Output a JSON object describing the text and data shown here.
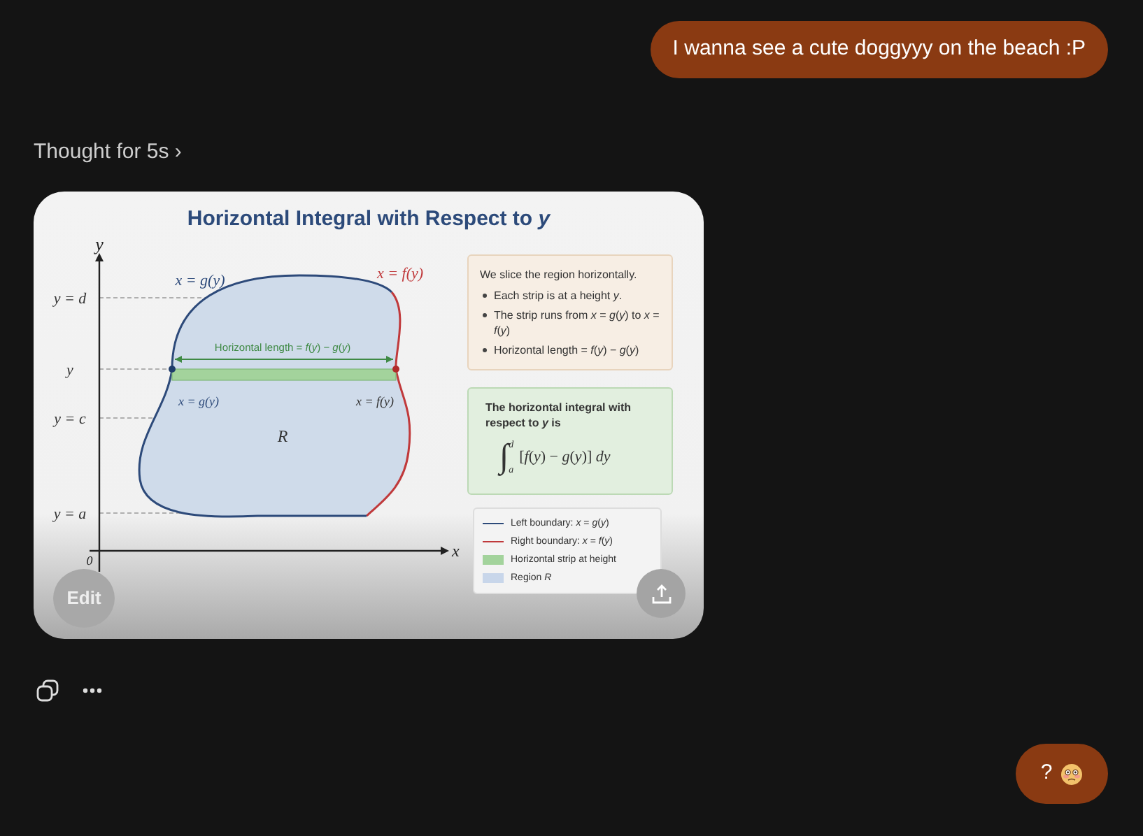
{
  "user_message": {
    "text": "I wanna see a cute doggyyy on the beach :P"
  },
  "thought": {
    "label": "Thought for 5s",
    "chevron": "›"
  },
  "image": {
    "title": "Horizontal Integral with Respect to *y*",
    "diagram": {
      "x_axis_label": "x",
      "y_axis_label": "y",
      "origin_label": "0",
      "level_labels": [
        "y = d",
        "y",
        "y = c",
        "y = a"
      ],
      "top_left_label": "x = g(y)",
      "top_right_label": "x = f(y)",
      "inner_left_label": "x = g(y)",
      "inner_right_label": "x = f(y)",
      "strip_label": "Horizontal length = *f*(*y*) − *g*(*y*)",
      "region_label": "R"
    },
    "explanation": {
      "intro": "We slice the region horizontally.",
      "bullets": [
        "Each strip is at a height *y*.",
        "The strip runs from *x* = *g*(*y*) to *x* = *f*(*y*)",
        "Horizontal length = *f*(*y*) − *g*(*y*)"
      ]
    },
    "integral_box": {
      "text": "The horizontal integral with respect to *y* is",
      "sign": "∫",
      "upper": "d",
      "lower": "a",
      "integrand": "[*f*(*y*) − *g*(*y*)] *dy*"
    },
    "legend": [
      {
        "kind": "line",
        "color": "#2d4a7a",
        "label": "Left boundary: *x* = *g*(*y*)"
      },
      {
        "kind": "line",
        "color": "#c0393b",
        "label": "Right boundary: *x* = *f*(*y*)"
      },
      {
        "kind": "swatch",
        "color": "#a3d39c",
        "label": "Horizontal strip at height"
      },
      {
        "kind": "swatch",
        "color": "#c8d6ea",
        "label": "Region *R*"
      }
    ],
    "edit_button": "Edit"
  },
  "reply": {
    "text": "?"
  }
}
